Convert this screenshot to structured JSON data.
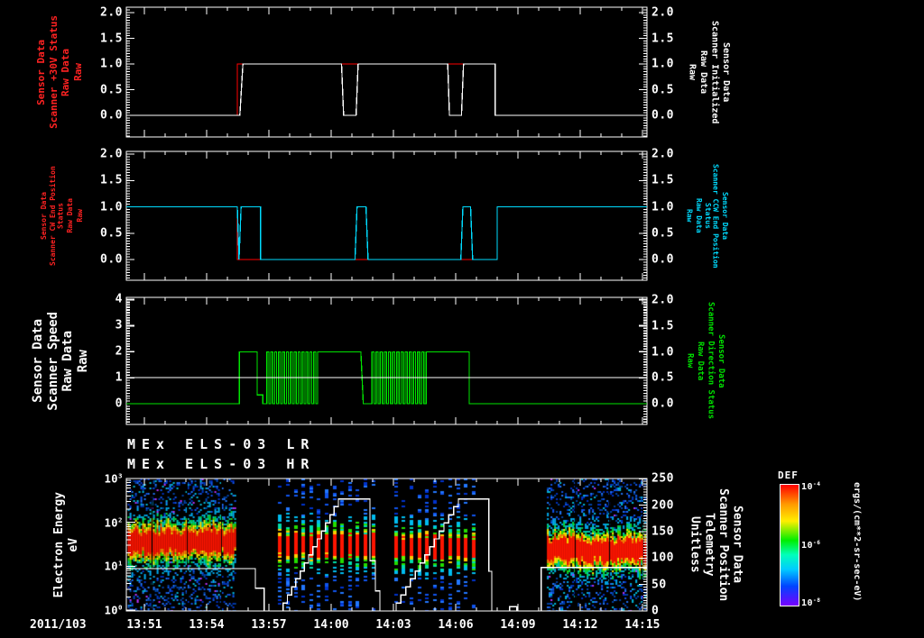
{
  "figure": {
    "date_label": "2011/103",
    "bg": "#000000"
  },
  "time_axis": {
    "range_minutes": [
      0.13,
      25.22
    ],
    "tick_minutes": [
      1,
      4,
      7,
      10,
      13,
      16,
      19,
      22,
      25
    ],
    "tick_labels": [
      "13:51",
      "13:54",
      "13:57",
      "14:00",
      "14:03",
      "14:06",
      "14:09",
      "14:12",
      "14:15"
    ],
    "minor_step_min": 1
  },
  "chart_data": [
    {
      "id": "panel-scanner-30v",
      "type": "line",
      "y_left": {
        "lines": [
          "Sensor Data",
          "Scanner +30V Status",
          "Raw Data",
          "Raw"
        ],
        "color": "#ff2222",
        "tick_labels": [
          "0.0",
          "0.5",
          "1.0",
          "1.5",
          "2.0"
        ],
        "tick_values": [
          0,
          0.5,
          1,
          1.5,
          2
        ],
        "range": [
          0,
          2
        ]
      },
      "y_right": {
        "lines": [
          "Sensor Data",
          "Scanner Initialized",
          "Raw Data",
          "Raw"
        ],
        "color": "#ffffff",
        "tick_labels": [
          "0.0",
          "0.5",
          "1.0",
          "1.5",
          "2.0"
        ],
        "tick_values": [
          0,
          0.5,
          1,
          1.5,
          2
        ],
        "range": [
          0,
          2
        ]
      },
      "series": [
        {
          "name": "scanner-30v-status",
          "color": "#ff0000",
          "axis": "left",
          "points": [
            [
              0.13,
              0
            ],
            [
              5.48,
              0
            ],
            [
              5.48,
              1
            ],
            [
              17.9,
              1
            ],
            [
              17.9,
              0
            ],
            [
              25.22,
              0
            ]
          ]
        },
        {
          "name": "scanner-initialized",
          "color": "#ffffff",
          "axis": "left",
          "points": [
            [
              0.13,
              0
            ],
            [
              5.6,
              0
            ],
            [
              5.75,
              1
            ],
            [
              10.5,
              1
            ],
            [
              10.6,
              0
            ],
            [
              11.2,
              0
            ],
            [
              11.3,
              1
            ],
            [
              15.62,
              1
            ],
            [
              15.7,
              0
            ],
            [
              16.28,
              0
            ],
            [
              16.38,
              1
            ],
            [
              17.9,
              1
            ],
            [
              17.9,
              0
            ],
            [
              25.22,
              0
            ]
          ]
        }
      ]
    },
    {
      "id": "panel-scanner-end-position",
      "type": "line",
      "y_left": {
        "lines": [
          "Sensor Data",
          "Scanner CW End Position Status",
          "Raw Data",
          "Raw"
        ],
        "color": "#ff2222",
        "tick_labels": [
          "0.0",
          "0.5",
          "1.0",
          "1.5",
          "2.0"
        ],
        "tick_values": [
          0,
          0.5,
          1,
          1.5,
          2
        ],
        "range": [
          0,
          2
        ]
      },
      "y_right": {
        "lines": [
          "Sensor Data",
          "Scanner CCW End Position Status",
          "Raw Data",
          "Raw"
        ],
        "color": "#00dcff",
        "tick_labels": [
          "0.0",
          "0.5",
          "1.0",
          "1.5",
          "2.0"
        ],
        "tick_values": [
          0,
          0.5,
          1,
          1.5,
          2
        ],
        "range": [
          0,
          2
        ]
      },
      "series": [
        {
          "name": "cw-end-position-status",
          "color": "#ff0000",
          "axis": "left",
          "points": [
            [
              0.13,
              1
            ],
            [
              5.48,
              1
            ],
            [
              5.48,
              0
            ],
            [
              18.0,
              0
            ],
            [
              18.0,
              1
            ],
            [
              25.22,
              1
            ]
          ]
        },
        {
          "name": "ccw-end-position-status",
          "color": "#00dcff",
          "axis": "left",
          "points": [
            [
              0.13,
              1
            ],
            [
              5.48,
              1
            ],
            [
              5.56,
              0
            ],
            [
              5.66,
              1
            ],
            [
              6.6,
              1
            ],
            [
              6.6,
              0
            ],
            [
              11.15,
              0
            ],
            [
              11.25,
              1
            ],
            [
              11.68,
              1
            ],
            [
              11.78,
              0
            ],
            [
              16.25,
              0
            ],
            [
              16.35,
              1
            ],
            [
              16.72,
              1
            ],
            [
              16.82,
              0
            ],
            [
              18.0,
              0
            ],
            [
              18.0,
              1
            ],
            [
              25.22,
              1
            ]
          ]
        }
      ]
    },
    {
      "id": "panel-scanner-speed",
      "type": "line",
      "y_left": {
        "lines": [
          "Sensor Data",
          "Scanner Speed",
          "Raw Data",
          "Raw"
        ],
        "color": "#ffffff",
        "tick_labels": [
          "0",
          "1",
          "2",
          "3",
          "4"
        ],
        "tick_values": [
          0,
          1,
          2,
          3,
          4
        ],
        "range": [
          0,
          4
        ]
      },
      "y_right": {
        "lines": [
          "Sensor Data",
          "Scanner Direction Status",
          "Raw Data",
          "Raw"
        ],
        "color": "#00e400",
        "tick_labels": [
          "0.0",
          "0.5",
          "1.0",
          "1.5",
          "2.0"
        ],
        "tick_values": [
          0,
          0.5,
          1,
          1.5,
          2
        ],
        "range": [
          0,
          2
        ]
      },
      "series": [
        {
          "name": "scanner-direction-status",
          "color": "#00e400",
          "axis": "right",
          "segments": [
            {
              "points": [
                [
                  0.13,
                  0
                ],
                [
                  5.57,
                  0
                ],
                [
                  5.57,
                  1
                ],
                [
                  6.43,
                  1
                ],
                [
                  6.43,
                  0.17
                ],
                [
                  6.7,
                  0.17
                ],
                [
                  6.7,
                  0
                ],
                [
                  6.9,
                  0
                ]
              ]
            },
            {
              "osc": [
                6.9,
                9.35,
                13
              ]
            },
            {
              "points": [
                [
                  9.35,
                  1
                ],
                [
                  11.43,
                  1
                ],
                [
                  11.55,
                  0
                ],
                [
                  11.96,
                  0
                ]
              ]
            },
            {
              "osc": [
                11.96,
                14.57,
                13
              ]
            },
            {
              "points": [
                [
                  14.57,
                  1
                ],
                [
                  16.65,
                  1
                ],
                [
                  16.65,
                  0
                ],
                [
                  25.22,
                  0
                ]
              ]
            }
          ]
        },
        {
          "name": "scanner-speed",
          "color": "#ffffff",
          "axis": "left",
          "points": [
            [
              0.13,
              1
            ],
            [
              25.22,
              1
            ]
          ]
        }
      ]
    },
    {
      "id": "panel-els-spectrogram",
      "type": "heatmap",
      "titles": [
        "MEx ELS-03 LR",
        "MEx ELS-03 HR"
      ],
      "y_left": {
        "lines": [
          "Electron Energy",
          "eV"
        ],
        "color": "#ffffff",
        "tick_exponents": [
          0,
          1,
          2,
          3
        ]
      },
      "y_right": {
        "lines": [
          "Sensor Data",
          "Scanner Position",
          "Telemetry",
          "Unitless"
        ],
        "color": "#ffffff",
        "tick_labels": [
          "0",
          "50",
          "100",
          "150",
          "200",
          "250"
        ],
        "tick_values": [
          0,
          50,
          100,
          150,
          200,
          250
        ],
        "range": [
          0,
          250
        ]
      },
      "bursts": [
        {
          "t": [
            0.2,
            5.4
          ],
          "style": "dense",
          "band_center_log": 1.58,
          "band_half_log": 0.3,
          "dividers_t": [
            1.35,
            3.04,
            4.7
          ]
        },
        {
          "t": [
            7.45,
            12.3
          ],
          "style": "striped",
          "band_center_log": 1.5,
          "band_half_log": 0.26,
          "dividers_t": []
        },
        {
          "t": [
            13.04,
            17.0
          ],
          "style": "striped",
          "band_center_log": 1.45,
          "band_half_log": 0.26,
          "dividers_t": []
        },
        {
          "t": [
            20.4,
            25.1
          ],
          "style": "dense",
          "band_center_log": 1.38,
          "band_half_log": 0.28,
          "dividers_t": [
            21.74,
            23.39,
            25.04
          ]
        }
      ],
      "scan_line": {
        "name": "scanner-position-telemetry",
        "color": "#ffffff",
        "steps": [
          [
            0.13,
            80
          ],
          [
            6.35,
            80
          ],
          [
            6.35,
            43
          ],
          [
            6.78,
            43
          ],
          [
            6.78,
            0
          ],
          [
            7.48,
            0
          ],
          {
            "ramp": [
              7.48,
              0,
              10.35,
              212,
              14
            ]
          },
          [
            11.87,
            212
          ],
          [
            11.87,
            95
          ],
          [
            12.13,
            95
          ],
          [
            12.13,
            38
          ],
          [
            12.35,
            38
          ],
          [
            12.35,
            0
          ],
          [
            12.9,
            0
          ],
          {
            "ramp": [
              12.9,
              0,
              16.13,
              212,
              14
            ]
          },
          [
            17.6,
            212
          ],
          [
            17.6,
            75
          ],
          [
            17.74,
            75
          ],
          [
            17.74,
            0
          ],
          [
            18.6,
            0
          ],
          [
            18.6,
            8
          ],
          [
            18.95,
            8
          ],
          [
            18.95,
            0
          ],
          [
            20.13,
            0
          ],
          [
            20.13,
            82
          ],
          [
            25.22,
            82
          ]
        ]
      }
    }
  ],
  "colorbar": {
    "title": "DEF",
    "unit": "ergs/(cm**2-sr-sec-eV)",
    "tick_exponents": [
      -4,
      -6,
      -8
    ],
    "gradient": [
      "#ff0000",
      "#ff9900",
      "#ffee00",
      "#00ee00",
      "#00ffbb",
      "#00ccff",
      "#0044ff",
      "#7700ff"
    ]
  }
}
